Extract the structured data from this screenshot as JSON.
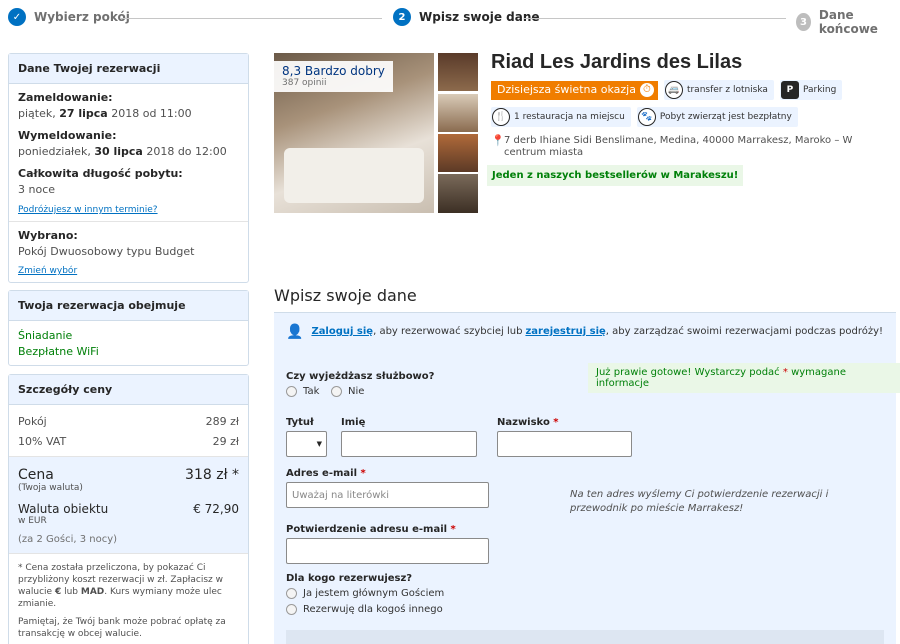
{
  "steps": [
    {
      "num": "✓",
      "label": "Wybierz pokój"
    },
    {
      "num": "2",
      "label": "Wpisz swoje dane"
    },
    {
      "num": "3",
      "label": "Dane końcowe"
    }
  ],
  "reservation": {
    "header": "Dane Twojej rezerwacji",
    "checkin_label": "Zameldowanie:",
    "checkin_day": "piątek,",
    "checkin_date": "27 lipca",
    "checkin_rest": "2018 od 11:00",
    "checkout_label": "Wymeldowanie:",
    "checkout_day": "poniedziałek,",
    "checkout_date": "30 lipca",
    "checkout_rest": "2018 do 12:00",
    "length_label": "Całkowita długość pobytu:",
    "length_value": "3 noce",
    "other_dates_link": "Podróżujesz w innym terminie?",
    "selected_label": "Wybrano:",
    "selected_value": "Pokój Dwuosobowy typu Budget",
    "change_link": "Zmień wybór"
  },
  "includes": {
    "header": "Twoja rezerwacja obejmuje",
    "items": [
      "Śniadanie",
      "Bezpłatne WiFi"
    ]
  },
  "price": {
    "header": "Szczegóły ceny",
    "room_label": "Pokój",
    "room_value": "289 zł",
    "vat_label": "10% VAT",
    "vat_value": "29 zł",
    "total_label": "Cena",
    "total_value": "318 zł *",
    "total_sub": "(Twoja waluta)",
    "local_label": "Waluta obiektu",
    "local_value": "€ 72,90",
    "local_sub": "w EUR",
    "guests": "(za 2 Gości, 3 nocy)",
    "note1_a": "* Cena została przeliczona, by pokazać Ci przybliżony koszt rezerwacji w zł. Zapłacisz w walucie",
    "note1_b": "€",
    "note1_c": "lub",
    "note1_d": "MAD",
    "note1_e": ". Kurs wymiany może ulec zmianie.",
    "note2": "Pamiętaj, że Twój bank może pobrać opłatę za transakcję w obcej walucie."
  },
  "hotel": {
    "score": "8,3 Bardzo dobry",
    "reviews": "387 opinii",
    "name": "Riad Les Jardins des Lilas",
    "deal": "Dzisiejsza świetna okazja",
    "facilities": [
      "transfer z lotniska",
      "Parking",
      "1 restauracja na miejscu",
      "Pobyt zwierząt jest bezpłatny"
    ],
    "address": "7 derb Ihiane Sidi Benslimane, Medina, 40000 Marrakesz, Maroko – W centrum miasta",
    "bestseller": "Jeden z naszych bestsellerów w Marakeszu!"
  },
  "form": {
    "title": "Wpisz swoje dane",
    "login_link": "Zaloguj się",
    "login_mid": ", aby rezerwować szybciej lub",
    "register_link": "zarejestruj się",
    "login_end": ", aby zarządzać swoimi rezerwacjami podczas podróży!",
    "almost_a": "Już prawie gotowe! Wystarczy podać",
    "almost_star": "*",
    "almost_b": "wymagane informacje",
    "business_label": "Czy wyjeżdżasz służbowo?",
    "yes": "Tak",
    "no": "Nie",
    "title_label": "Tytuł",
    "first_label": "Imię",
    "last_label": "Nazwisko",
    "email_label": "Adres e-mail",
    "email_placeholder": "Uważaj na literówki",
    "confirm_label": "Potwierdzenie adresu e-mail",
    "email_note": "Na ten adres wyślemy Ci potwierdzenie rezerwacji i przewodnik po mieście Marrakesz!",
    "for_whom_label": "Dla kogo rezerwujesz?",
    "for_me": "Ja jestem głównym Gościem",
    "for_other": "Rezerwuję dla kogoś innego",
    "req": "*"
  }
}
